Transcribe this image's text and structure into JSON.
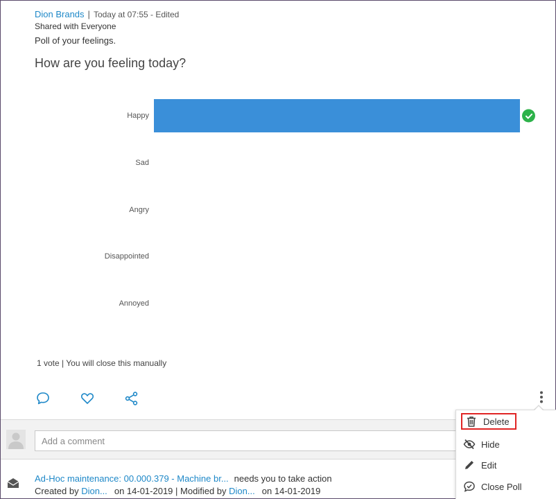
{
  "post": {
    "author": "Dion Brands",
    "separator": "|",
    "time": "Today at 07:55 - Edited",
    "shared": "Shared with Everyone",
    "body": "Poll of your feelings."
  },
  "poll": {
    "question": "How are you feeling today?",
    "options": [
      {
        "label": "Happy",
        "fraction": 1.0,
        "selected": true
      },
      {
        "label": "Sad",
        "fraction": 0.0,
        "selected": false
      },
      {
        "label": "Angry",
        "fraction": 0.0,
        "selected": false
      },
      {
        "label": "Disappointed",
        "fraction": 0.0,
        "selected": false
      },
      {
        "label": "Annoyed",
        "fraction": 0.0,
        "selected": false
      }
    ],
    "vote_info": "1 vote | You will close this manually",
    "bar_color": "#3a8fd9",
    "check_color": "#2db24a"
  },
  "actions": {
    "comment_icon": "comment-icon",
    "like_icon": "heart-icon",
    "share_icon": "share-icon",
    "more_icon": "more-vertical-icon"
  },
  "comment": {
    "placeholder": "Add a comment"
  },
  "task": {
    "link": "Ad-Hoc maintenance: 00.000.379 - Machine br...",
    "rest": "needs you to take action",
    "created_by_label": "Created by",
    "created_by": "Dion...",
    "created_on": "on 14-01-2019",
    "modified_label": "| Modified by",
    "modified_by": "Dion...",
    "modified_on": "on 14-01-2019"
  },
  "menu": {
    "items": [
      {
        "label": "Delete",
        "icon": "trash-icon"
      },
      {
        "label": "Hide",
        "icon": "eye-off-icon"
      },
      {
        "label": "Edit",
        "icon": "pencil-icon"
      },
      {
        "label": "Close Poll",
        "icon": "chat-check-icon"
      }
    ],
    "highlight_color": "#e02424"
  }
}
